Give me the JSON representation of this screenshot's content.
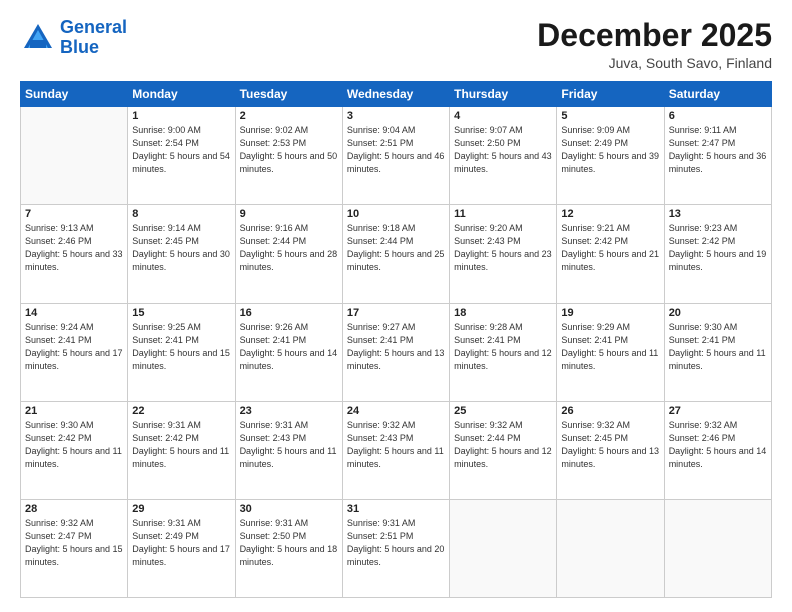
{
  "logo": {
    "line1": "General",
    "line2": "Blue"
  },
  "title": "December 2025",
  "subtitle": "Juva, South Savo, Finland",
  "days_of_week": [
    "Sunday",
    "Monday",
    "Tuesday",
    "Wednesday",
    "Thursday",
    "Friday",
    "Saturday"
  ],
  "weeks": [
    [
      {
        "day": "",
        "sunrise": "",
        "sunset": "",
        "daylight": ""
      },
      {
        "day": "1",
        "sunrise": "Sunrise: 9:00 AM",
        "sunset": "Sunset: 2:54 PM",
        "daylight": "Daylight: 5 hours and 54 minutes."
      },
      {
        "day": "2",
        "sunrise": "Sunrise: 9:02 AM",
        "sunset": "Sunset: 2:53 PM",
        "daylight": "Daylight: 5 hours and 50 minutes."
      },
      {
        "day": "3",
        "sunrise": "Sunrise: 9:04 AM",
        "sunset": "Sunset: 2:51 PM",
        "daylight": "Daylight: 5 hours and 46 minutes."
      },
      {
        "day": "4",
        "sunrise": "Sunrise: 9:07 AM",
        "sunset": "Sunset: 2:50 PM",
        "daylight": "Daylight: 5 hours and 43 minutes."
      },
      {
        "day": "5",
        "sunrise": "Sunrise: 9:09 AM",
        "sunset": "Sunset: 2:49 PM",
        "daylight": "Daylight: 5 hours and 39 minutes."
      },
      {
        "day": "6",
        "sunrise": "Sunrise: 9:11 AM",
        "sunset": "Sunset: 2:47 PM",
        "daylight": "Daylight: 5 hours and 36 minutes."
      }
    ],
    [
      {
        "day": "7",
        "sunrise": "Sunrise: 9:13 AM",
        "sunset": "Sunset: 2:46 PM",
        "daylight": "Daylight: 5 hours and 33 minutes."
      },
      {
        "day": "8",
        "sunrise": "Sunrise: 9:14 AM",
        "sunset": "Sunset: 2:45 PM",
        "daylight": "Daylight: 5 hours and 30 minutes."
      },
      {
        "day": "9",
        "sunrise": "Sunrise: 9:16 AM",
        "sunset": "Sunset: 2:44 PM",
        "daylight": "Daylight: 5 hours and 28 minutes."
      },
      {
        "day": "10",
        "sunrise": "Sunrise: 9:18 AM",
        "sunset": "Sunset: 2:44 PM",
        "daylight": "Daylight: 5 hours and 25 minutes."
      },
      {
        "day": "11",
        "sunrise": "Sunrise: 9:20 AM",
        "sunset": "Sunset: 2:43 PM",
        "daylight": "Daylight: 5 hours and 23 minutes."
      },
      {
        "day": "12",
        "sunrise": "Sunrise: 9:21 AM",
        "sunset": "Sunset: 2:42 PM",
        "daylight": "Daylight: 5 hours and 21 minutes."
      },
      {
        "day": "13",
        "sunrise": "Sunrise: 9:23 AM",
        "sunset": "Sunset: 2:42 PM",
        "daylight": "Daylight: 5 hours and 19 minutes."
      }
    ],
    [
      {
        "day": "14",
        "sunrise": "Sunrise: 9:24 AM",
        "sunset": "Sunset: 2:41 PM",
        "daylight": "Daylight: 5 hours and 17 minutes."
      },
      {
        "day": "15",
        "sunrise": "Sunrise: 9:25 AM",
        "sunset": "Sunset: 2:41 PM",
        "daylight": "Daylight: 5 hours and 15 minutes."
      },
      {
        "day": "16",
        "sunrise": "Sunrise: 9:26 AM",
        "sunset": "Sunset: 2:41 PM",
        "daylight": "Daylight: 5 hours and 14 minutes."
      },
      {
        "day": "17",
        "sunrise": "Sunrise: 9:27 AM",
        "sunset": "Sunset: 2:41 PM",
        "daylight": "Daylight: 5 hours and 13 minutes."
      },
      {
        "day": "18",
        "sunrise": "Sunrise: 9:28 AM",
        "sunset": "Sunset: 2:41 PM",
        "daylight": "Daylight: 5 hours and 12 minutes."
      },
      {
        "day": "19",
        "sunrise": "Sunrise: 9:29 AM",
        "sunset": "Sunset: 2:41 PM",
        "daylight": "Daylight: 5 hours and 11 minutes."
      },
      {
        "day": "20",
        "sunrise": "Sunrise: 9:30 AM",
        "sunset": "Sunset: 2:41 PM",
        "daylight": "Daylight: 5 hours and 11 minutes."
      }
    ],
    [
      {
        "day": "21",
        "sunrise": "Sunrise: 9:30 AM",
        "sunset": "Sunset: 2:42 PM",
        "daylight": "Daylight: 5 hours and 11 minutes."
      },
      {
        "day": "22",
        "sunrise": "Sunrise: 9:31 AM",
        "sunset": "Sunset: 2:42 PM",
        "daylight": "Daylight: 5 hours and 11 minutes."
      },
      {
        "day": "23",
        "sunrise": "Sunrise: 9:31 AM",
        "sunset": "Sunset: 2:43 PM",
        "daylight": "Daylight: 5 hours and 11 minutes."
      },
      {
        "day": "24",
        "sunrise": "Sunrise: 9:32 AM",
        "sunset": "Sunset: 2:43 PM",
        "daylight": "Daylight: 5 hours and 11 minutes."
      },
      {
        "day": "25",
        "sunrise": "Sunrise: 9:32 AM",
        "sunset": "Sunset: 2:44 PM",
        "daylight": "Daylight: 5 hours and 12 minutes."
      },
      {
        "day": "26",
        "sunrise": "Sunrise: 9:32 AM",
        "sunset": "Sunset: 2:45 PM",
        "daylight": "Daylight: 5 hours and 13 minutes."
      },
      {
        "day": "27",
        "sunrise": "Sunrise: 9:32 AM",
        "sunset": "Sunset: 2:46 PM",
        "daylight": "Daylight: 5 hours and 14 minutes."
      }
    ],
    [
      {
        "day": "28",
        "sunrise": "Sunrise: 9:32 AM",
        "sunset": "Sunset: 2:47 PM",
        "daylight": "Daylight: 5 hours and 15 minutes."
      },
      {
        "day": "29",
        "sunrise": "Sunrise: 9:31 AM",
        "sunset": "Sunset: 2:49 PM",
        "daylight": "Daylight: 5 hours and 17 minutes."
      },
      {
        "day": "30",
        "sunrise": "Sunrise: 9:31 AM",
        "sunset": "Sunset: 2:50 PM",
        "daylight": "Daylight: 5 hours and 18 minutes."
      },
      {
        "day": "31",
        "sunrise": "Sunrise: 9:31 AM",
        "sunset": "Sunset: 2:51 PM",
        "daylight": "Daylight: 5 hours and 20 minutes."
      },
      {
        "day": "",
        "sunrise": "",
        "sunset": "",
        "daylight": ""
      },
      {
        "day": "",
        "sunrise": "",
        "sunset": "",
        "daylight": ""
      },
      {
        "day": "",
        "sunrise": "",
        "sunset": "",
        "daylight": ""
      }
    ]
  ]
}
